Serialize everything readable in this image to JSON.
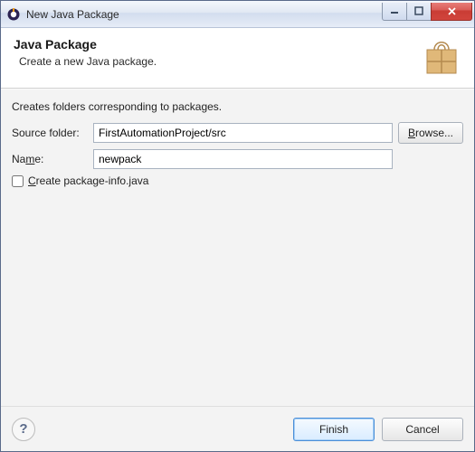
{
  "window": {
    "title": "New Java Package"
  },
  "banner": {
    "title": "Java Package",
    "description": "Create a new Java package."
  },
  "form": {
    "intro": "Creates folders corresponding to packages.",
    "source_folder_label": "Source folder:",
    "source_folder_value": "FirstAutomationProject/src",
    "browse_label": "Browse...",
    "name_label_pre": "Na",
    "name_label_ul": "m",
    "name_label_post": "e:",
    "name_value": "newpack",
    "checkbox_ul": "C",
    "checkbox_post": "reate package-info.java",
    "checkbox_checked": false
  },
  "buttons": {
    "finish": "Finish",
    "cancel": "Cancel"
  }
}
